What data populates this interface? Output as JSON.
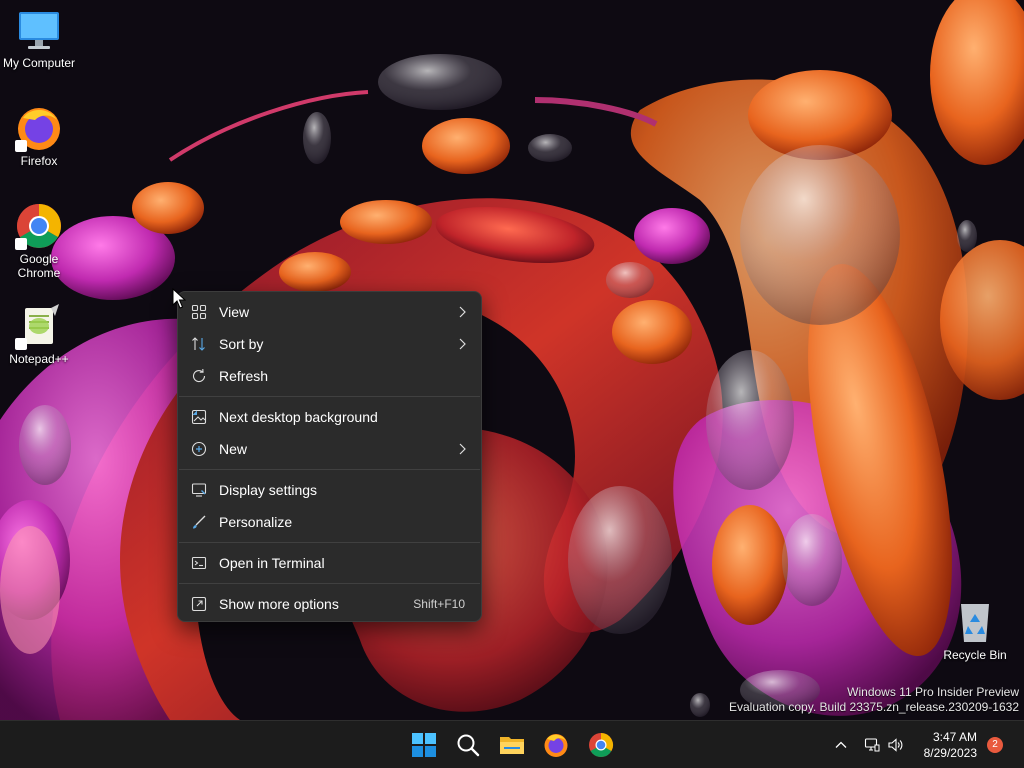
{
  "desktop": {
    "icons": [
      {
        "label": "My Computer"
      },
      {
        "label": "Firefox"
      },
      {
        "label": "Google Chrome"
      },
      {
        "label": "Notepad++"
      },
      {
        "label": "Recycle Bin"
      }
    ]
  },
  "context_menu": {
    "items": [
      {
        "label": "View",
        "icon": "grid-icon",
        "submenu": true
      },
      {
        "label": "Sort by",
        "icon": "sort-icon",
        "submenu": true
      },
      {
        "label": "Refresh",
        "icon": "refresh-icon",
        "submenu": false
      },
      {
        "label": "Next desktop background",
        "icon": "background-icon",
        "submenu": false
      },
      {
        "label": "New",
        "icon": "plus-circle-icon",
        "submenu": true
      },
      {
        "label": "Display settings",
        "icon": "display-icon",
        "submenu": false
      },
      {
        "label": "Personalize",
        "icon": "brush-icon",
        "submenu": false
      },
      {
        "label": "Open in Terminal",
        "icon": "terminal-icon",
        "submenu": false
      },
      {
        "label": "Show more options",
        "icon": "more-options-icon",
        "submenu": false,
        "shortcut": "Shift+F10"
      }
    ]
  },
  "watermark": {
    "line1": "Windows 11 Pro Insider Preview",
    "line2": "Evaluation copy. Build 23375.zn_release.230209-1632"
  },
  "taskbar": {
    "apps": [
      "start-icon",
      "search-icon",
      "file-explorer-icon",
      "firefox-icon",
      "chrome-icon"
    ],
    "time": "3:47 AM",
    "date": "8/29/2023",
    "notification_count": "2"
  },
  "colors": {
    "menu_bg": "#2b2b2b",
    "taskbar_bg": "#1c1c1c",
    "accent": "#0078d4"
  }
}
